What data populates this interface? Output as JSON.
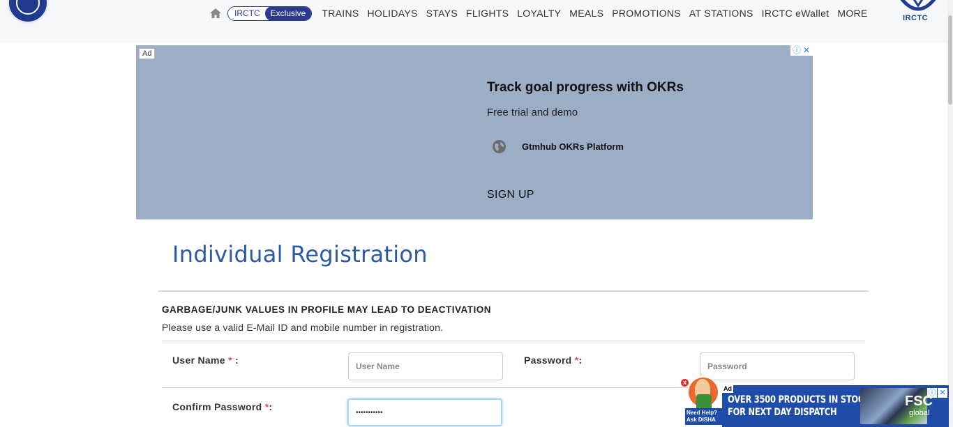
{
  "header": {
    "pill": {
      "left": "IRCTC",
      "right": "Exclusive"
    },
    "nav_items": [
      "TRAINS",
      "HOLIDAYS",
      "STAYS",
      "FLIGHTS",
      "LOYALTY",
      "MEALS",
      "PROMOTIONS",
      "AT STATIONS",
      "IRCTC eWallet",
      "MORE"
    ],
    "brand_right": "IRCTC"
  },
  "ad_banner": {
    "badge": "Ad",
    "title": "Track goal progress with OKRs",
    "subtitle": "Free trial and demo",
    "brand": "Gtmhub OKRs Platform",
    "cta": "SIGN UP",
    "info_glyph": "ⓘ",
    "close_glyph": "✕"
  },
  "registration": {
    "title": "Individual Registration",
    "warning": "GARBAGE/JUNK VALUES IN PROFILE MAY LEAD TO DEACTIVATION",
    "note": "Please use a valid E-Mail ID and mobile number in registration.",
    "username_label": "User Name",
    "username_suffix": " :",
    "username_placeholder": "User Name",
    "password_label": "Password",
    "password_suffix": ":",
    "password_placeholder": "Password",
    "confirm_label": "Confirm Password",
    "confirm_suffix": ":",
    "confirm_value": "•••••••••••",
    "required_mark": "*"
  },
  "bottom_ad": {
    "badge": "Ad",
    "line1": "OVER 3500 PRODUCTS IN STOCK",
    "line2": "FOR NEXT DAY DISPATCH",
    "logo": "FSC",
    "logo_sub": "global",
    "info_glyph": "ⓘ",
    "close_glyph": "✕"
  },
  "disha": {
    "line1": "Need Help?",
    "line2": "Ask DISHA",
    "close_glyph": "x"
  },
  "colors": {
    "brand_blue": "#2b3a8c",
    "title_blue": "#2c59a3",
    "ad_bg": "#9caec6",
    "required": "#d9534f"
  }
}
